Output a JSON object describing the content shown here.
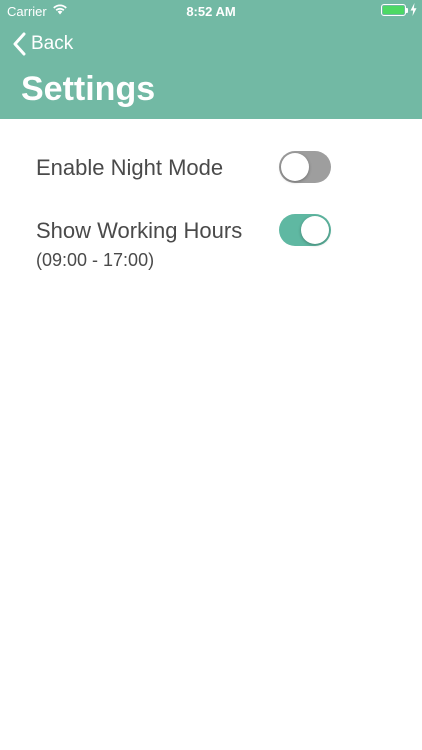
{
  "status_bar": {
    "carrier": "Carrier",
    "time": "8:52 AM",
    "wifi_icon": "wifi-icon",
    "battery_icon": "battery-icon",
    "charging_icon": "bolt-icon",
    "battery_level": 1.0
  },
  "nav": {
    "back_label": "Back",
    "back_icon": "chevron-left-icon",
    "title": "Settings"
  },
  "settings": [
    {
      "label": "Enable Night Mode",
      "sublabel": "",
      "enabled": false
    },
    {
      "label": "Show Working Hours",
      "sublabel": "(09:00 - 17:00)",
      "enabled": true
    }
  ],
  "colors": {
    "header": "#72b9a4",
    "toggle_on": "#5fb8a2",
    "toggle_off": "#9e9e9e",
    "text": "#4a4a4a",
    "battery": "#4cd964"
  }
}
